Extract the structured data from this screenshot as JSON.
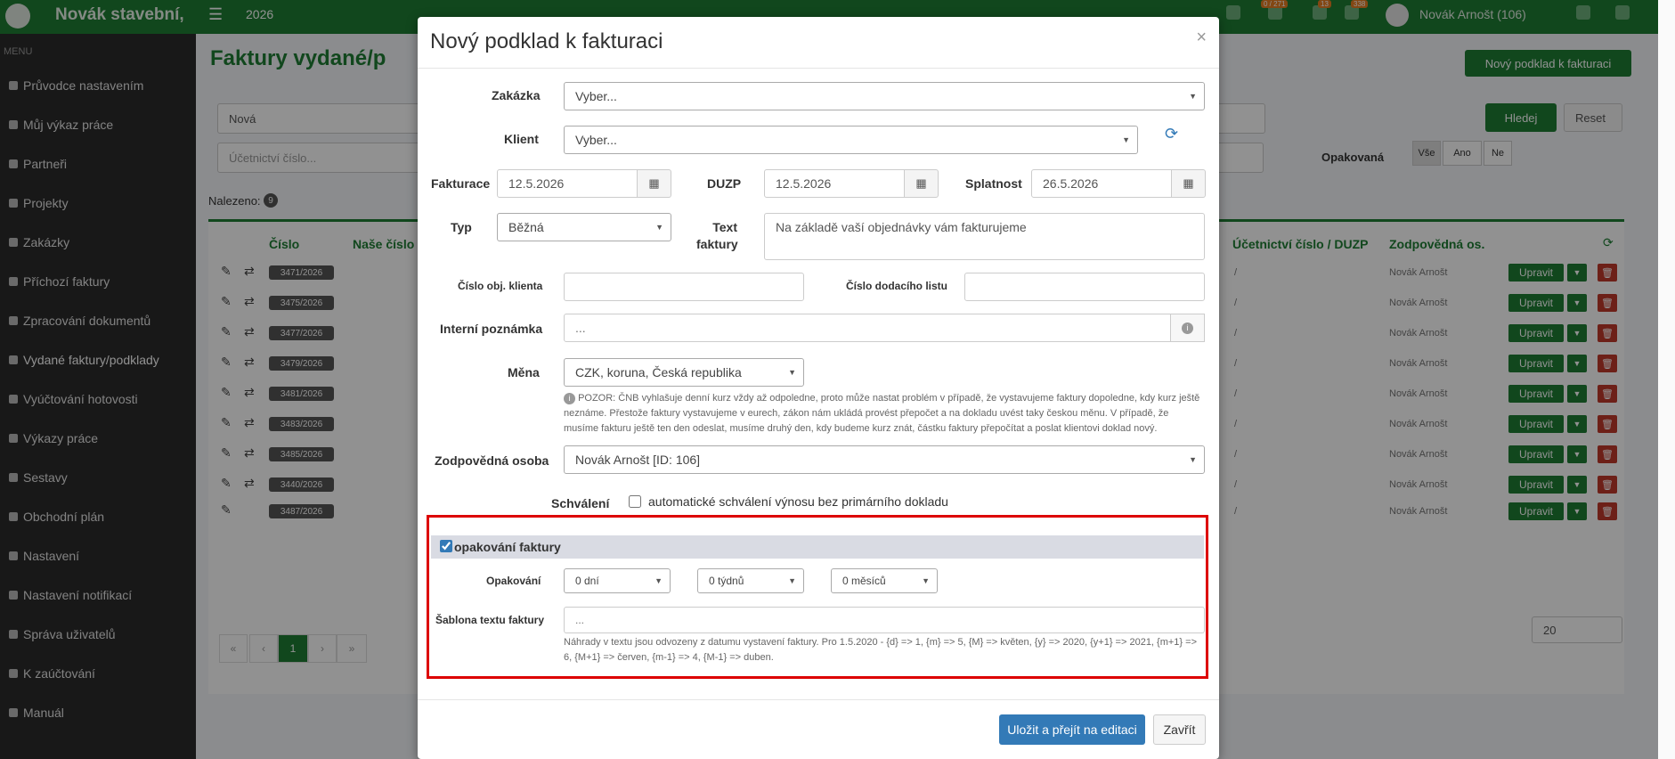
{
  "app": {
    "brand": "Novák stavební,",
    "year": "2026",
    "user": "Novák Arnošt (106)",
    "badges": [
      "0 / 271",
      "13",
      "338"
    ]
  },
  "sidebar": {
    "title": "MENU",
    "items": [
      {
        "label": "Průvodce nastavením"
      },
      {
        "label": "Můj výkaz práce"
      },
      {
        "label": "Partneři"
      },
      {
        "label": "Projekty"
      },
      {
        "label": "Zakázky"
      },
      {
        "label": "Příchozí faktury"
      },
      {
        "label": "Zpracování dokumentů"
      },
      {
        "label": "Vydané faktury/podklady"
      },
      {
        "label": "Vyúčtování hotovosti"
      },
      {
        "label": "Výkazy práce"
      },
      {
        "label": "Sestavy"
      },
      {
        "label": "Obchodní plán"
      },
      {
        "label": "Nastavení"
      },
      {
        "label": "Nastavení notifikací"
      },
      {
        "label": "Správa uživatelů"
      },
      {
        "label": "K zaúčtování"
      },
      {
        "label": "Manuál"
      }
    ]
  },
  "page": {
    "title": "Faktury vydané/p",
    "new_button": "Nový podklad k fakturaci",
    "filter_status": "Nová",
    "filter_account_placeholder": "Účetnictví číslo...",
    "search_button": "Hledej",
    "reset_button": "Reset",
    "repeated_label": "Opakovaná",
    "seg_all": "Vše",
    "seg_yes": "Ano",
    "seg_no": "Ne",
    "found_label": "Nalezeno:",
    "found_count": "9",
    "col_number": "Číslo",
    "col_our_number": "Naše číslo",
    "col_account": "Účetnictví číslo / DUZP",
    "col_responsible": "Zodpovědná os.",
    "rows": [
      {
        "number": "3471/2026",
        "account": "/",
        "responsible": "Novák Arnošt",
        "edit": "Upravit"
      },
      {
        "number": "3475/2026",
        "account": "/",
        "responsible": "Novák Arnošt",
        "edit": "Upravit"
      },
      {
        "number": "3477/2026",
        "account": "/",
        "responsible": "Novák Arnošt",
        "edit": "Upravit"
      },
      {
        "number": "3479/2026",
        "account": "/",
        "responsible": "Novák Arnošt",
        "edit": "Upravit"
      },
      {
        "number": "3481/2026",
        "account": "/",
        "responsible": "Novák Arnošt",
        "edit": "Upravit"
      },
      {
        "number": "3483/2026",
        "account": "/",
        "responsible": "Novák Arnošt",
        "edit": "Upravit"
      },
      {
        "number": "3485/2026",
        "account": "/",
        "responsible": "Novák Arnošt",
        "edit": "Upravit"
      },
      {
        "number": "3440/2026",
        "account": "/",
        "responsible": "Novák Arnošt",
        "edit": "Upravit"
      },
      {
        "number": "3487/2026",
        "account": "/",
        "responsible": "Novák Arnošt",
        "edit": "Upravit"
      }
    ],
    "pager": [
      "«",
      "‹",
      "1",
      "›",
      "»"
    ],
    "page_size": "20"
  },
  "modal": {
    "title": "Nový podklad k fakturaci",
    "close": "×",
    "zakazka_label": "Zakázka",
    "zakazka_value": "Vyber...",
    "klient_label": "Klient",
    "klient_value": "Vyber...",
    "fakturace_label": "Fakturace",
    "fakturace_value": "12.5.2026",
    "duzp_label": "DUZP",
    "duzp_value": "12.5.2026",
    "splatnost_label": "Splatnost",
    "splatnost_value": "26.5.2026",
    "typ_label": "Typ",
    "typ_value": "Běžná",
    "text_label_1": "Text",
    "text_label_2": "faktury",
    "text_value": "Na základě vaší objednávky vám fakturujeme",
    "cislo_obj_label": "Číslo obj. klienta",
    "cislo_obj_value": "",
    "cislo_dod_label": "Číslo dodacího listu",
    "cislo_dod_value": "",
    "interni_label": "Interní poznámka",
    "interni_placeholder": "...",
    "mena_label": "Měna",
    "mena_value": "CZK, koruna, Česká republika",
    "mena_note": "POZOR: ČNB vyhlašuje denní kurz vždy až odpoledne, proto může nastat problém v případě, že vystavujeme faktury dopoledne, kdy kurz ještě neznáme. Přestože faktury vystavujeme v eurech, zákon nám ukládá provést přepočet a na dokladu uvést taky českou měnu. V případě, že musíme fakturu ještě ten den odeslat, musíme druhý den, kdy budeme kurz znát, částku faktury přepočítat a poslat klientovi doklad nový.",
    "zodpovedna_label": "Zodpovědná osoba",
    "zodpovedna_value": "Novák Arnošt [ID: 106]",
    "schvaleni_label": "Schválení",
    "schvaleni_checkbox": "automatické schválení výnosu bez primárního dokladu",
    "opakovani_checkbox": "opakování faktury",
    "opakovani_label": "Opakování",
    "days_value": "0 dní",
    "weeks_value": "0 týdnů",
    "months_value": "0 měsíců",
    "sablona_label": "Šablona textu faktury",
    "sablona_placeholder": "...",
    "sablona_note": "Náhrady v textu jsou odvozeny z datumu vystavení faktury. Pro 1.5.2020 - {d} => 1, {m} => 5, {M} => květen, {y} => 2020, {y+1} => 2021, {m+1} => 6, {M+1} => červen, {m-1} => 4, {M-1} => duben.",
    "save_button": "Uložit a přejít na editaci",
    "close_button": "Zavřít"
  },
  "colors": {
    "brand_green": "#1e7e34",
    "highlight_red": "#dd0000",
    "primary_blue": "#337ab7"
  }
}
